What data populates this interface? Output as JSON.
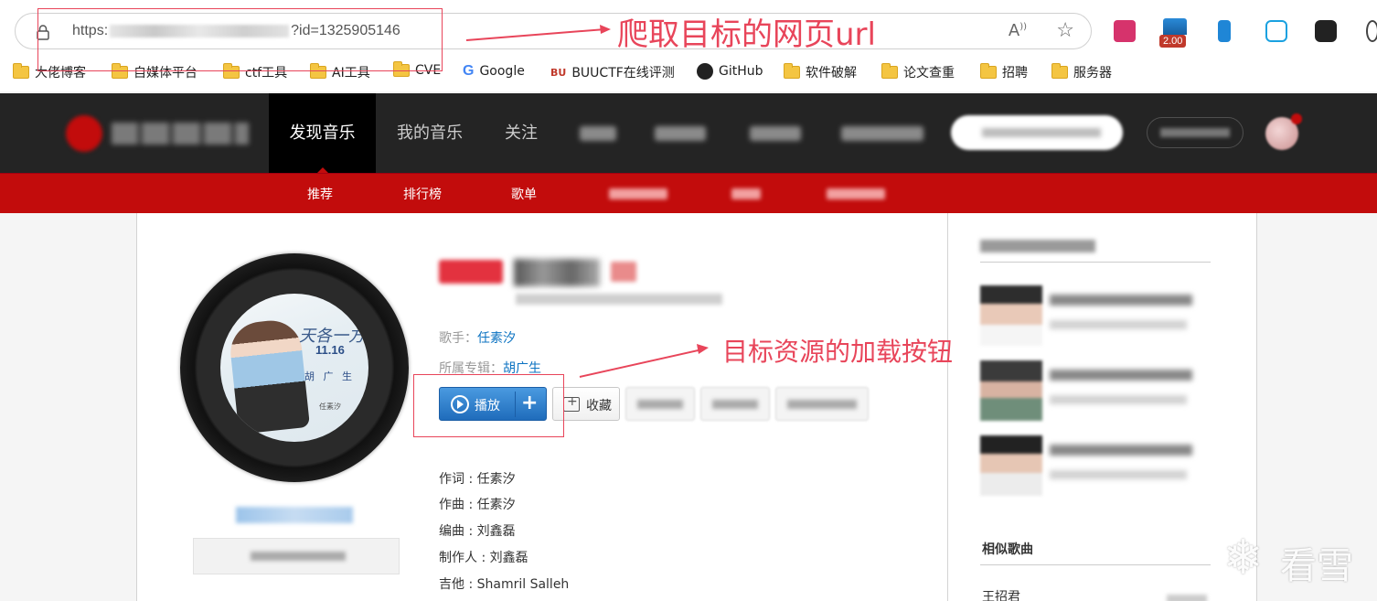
{
  "browser": {
    "url_prefix": "https:",
    "url_suffix": "?id=1325905146",
    "extension_badge": "2.00"
  },
  "bookmarks": [
    {
      "label": "大佬博客",
      "icon": "folder-icon"
    },
    {
      "label": "自媒体平台",
      "icon": "folder-icon"
    },
    {
      "label": "ctf工具",
      "icon": "folder-icon"
    },
    {
      "label": "AI工具",
      "icon": "folder-icon"
    },
    {
      "label": "CVE",
      "icon": "folder-icon"
    },
    {
      "label": "Google",
      "icon": "google-icon"
    },
    {
      "label": "BUUCTF在线评测",
      "icon": "buuctf-icon"
    },
    {
      "label": "GitHub",
      "icon": "github-icon"
    },
    {
      "label": "软件破解",
      "icon": "folder-icon"
    },
    {
      "label": "论文查重",
      "icon": "folder-icon"
    },
    {
      "label": "招聘",
      "icon": "folder-icon"
    },
    {
      "label": "服务器",
      "icon": "folder-icon"
    }
  ],
  "annotations": {
    "url_note": "爬取目标的网页url",
    "button_note": "目标资源的加载按钮",
    "color": "#e8455a"
  },
  "nav": {
    "items": [
      "发现音乐",
      "我的音乐",
      "关注"
    ],
    "active_index": 0,
    "sub_items": [
      "推荐",
      "排行榜",
      "歌单"
    ]
  },
  "cover": {
    "title": "天各一方",
    "date": "11.16",
    "artist_line": "胡 广 生",
    "small_text": "任素汐"
  },
  "song": {
    "singer_label": "歌手：",
    "singer": "任素汐",
    "album_label": "所属专辑：",
    "album": "胡广生",
    "play_label": "播放",
    "add_label": "+",
    "fav_label": "收藏",
    "credits": [
      "作词 : 任素汐",
      "作曲 : 任素汐",
      "编曲 : 刘鑫磊",
      "制作人 : 刘鑫磊",
      "吉他 : Shamril Salleh"
    ]
  },
  "sidebar": {
    "similar_title": "相似歌曲",
    "first_song": "王招君"
  },
  "watermark": {
    "text": "看雪"
  },
  "colors": {
    "topbar": "#242424",
    "subbar": "#c20c0c",
    "link": "#0c73c2",
    "play_button": "#2a7fd4"
  }
}
